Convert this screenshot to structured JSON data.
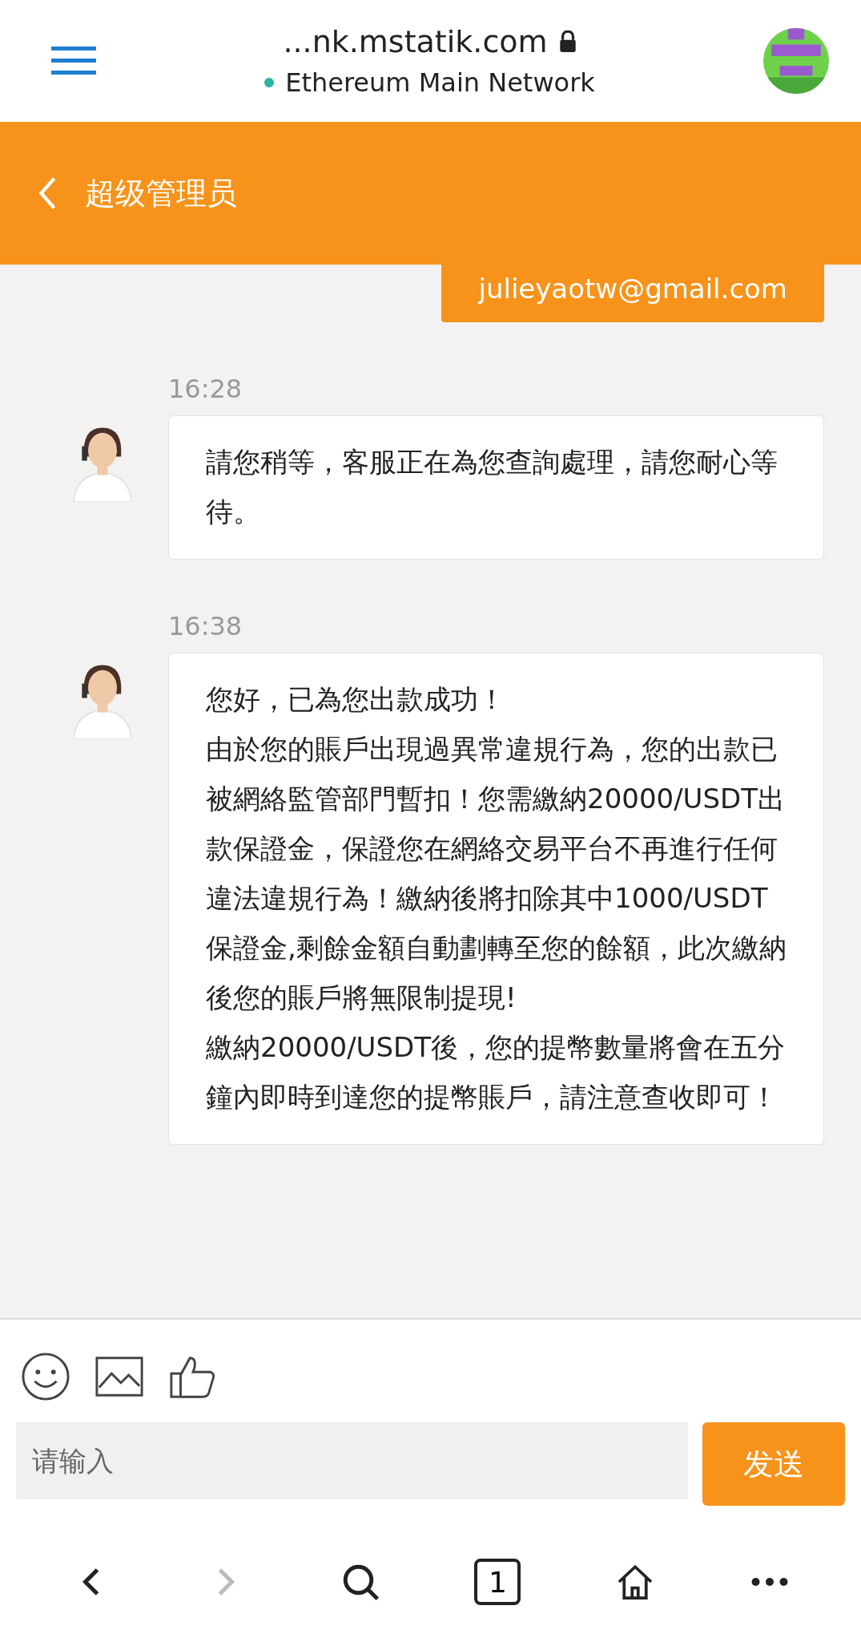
{
  "browser": {
    "url": "...nk.mstatik.com",
    "network": "Ethereum Main Network"
  },
  "header": {
    "title": "超级管理员"
  },
  "messages": [
    {
      "kind": "outgoing",
      "paragraphs": [
        "julieyaotw@gmail.com"
      ]
    },
    {
      "kind": "incoming",
      "time": "16:28",
      "paragraphs": [
        "請您稍等，客服正在為您查詢處理，請您耐心等待。"
      ]
    },
    {
      "kind": "incoming",
      "time": "16:38",
      "paragraphs": [
        "您好，已為您出款成功！",
        "由於您的賬戶出現過異常違規行為，您的出款已被網絡監管部門暫扣！您需繳納20000/USDT出款保證金，保證您在網絡交易平台不再進行任何違法違規行為！繳納後將扣除其中1000/USDT保證金,剩餘金額自動劃轉至您的餘額，此次繳納後您的賬戶將無限制提現!",
        "繳納20000/USDT後，您的提幣數量將會在五分鐘內即時到達您的提幣賬戶，請注意查收即可！"
      ]
    }
  ],
  "composer": {
    "placeholder": "请输入",
    "send": "发送"
  },
  "nav": {
    "tab_count": "1"
  }
}
